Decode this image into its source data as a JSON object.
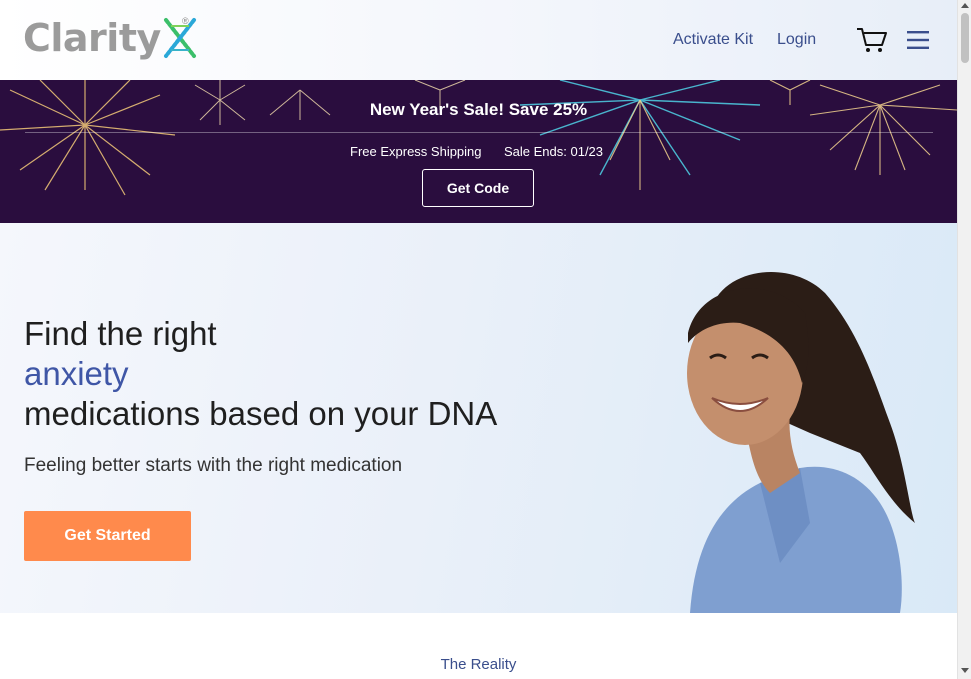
{
  "header": {
    "logo_text": "Clarity",
    "logo_mark": "X",
    "logo_reg": "®",
    "nav": {
      "activate_kit": "Activate Kit",
      "login": "Login"
    },
    "icons": {
      "cart": "cart-icon",
      "menu": "hamburger-menu-icon"
    }
  },
  "promo": {
    "title": "New Year's Sale! Save 25%",
    "shipping": "Free Express Shipping",
    "sale_ends": "Sale Ends: 01/23",
    "button": "Get Code",
    "background_color": "#2a0d3e"
  },
  "hero": {
    "line1": "Find the right",
    "line2": "anxiety",
    "line3": "medications based on your DNA",
    "subtitle": "Feeling better starts with the right medication",
    "cta": "Get Started",
    "accent_color": "#3f56a6",
    "cta_color": "#ff8a4c"
  },
  "section": {
    "label": "The Reality"
  }
}
